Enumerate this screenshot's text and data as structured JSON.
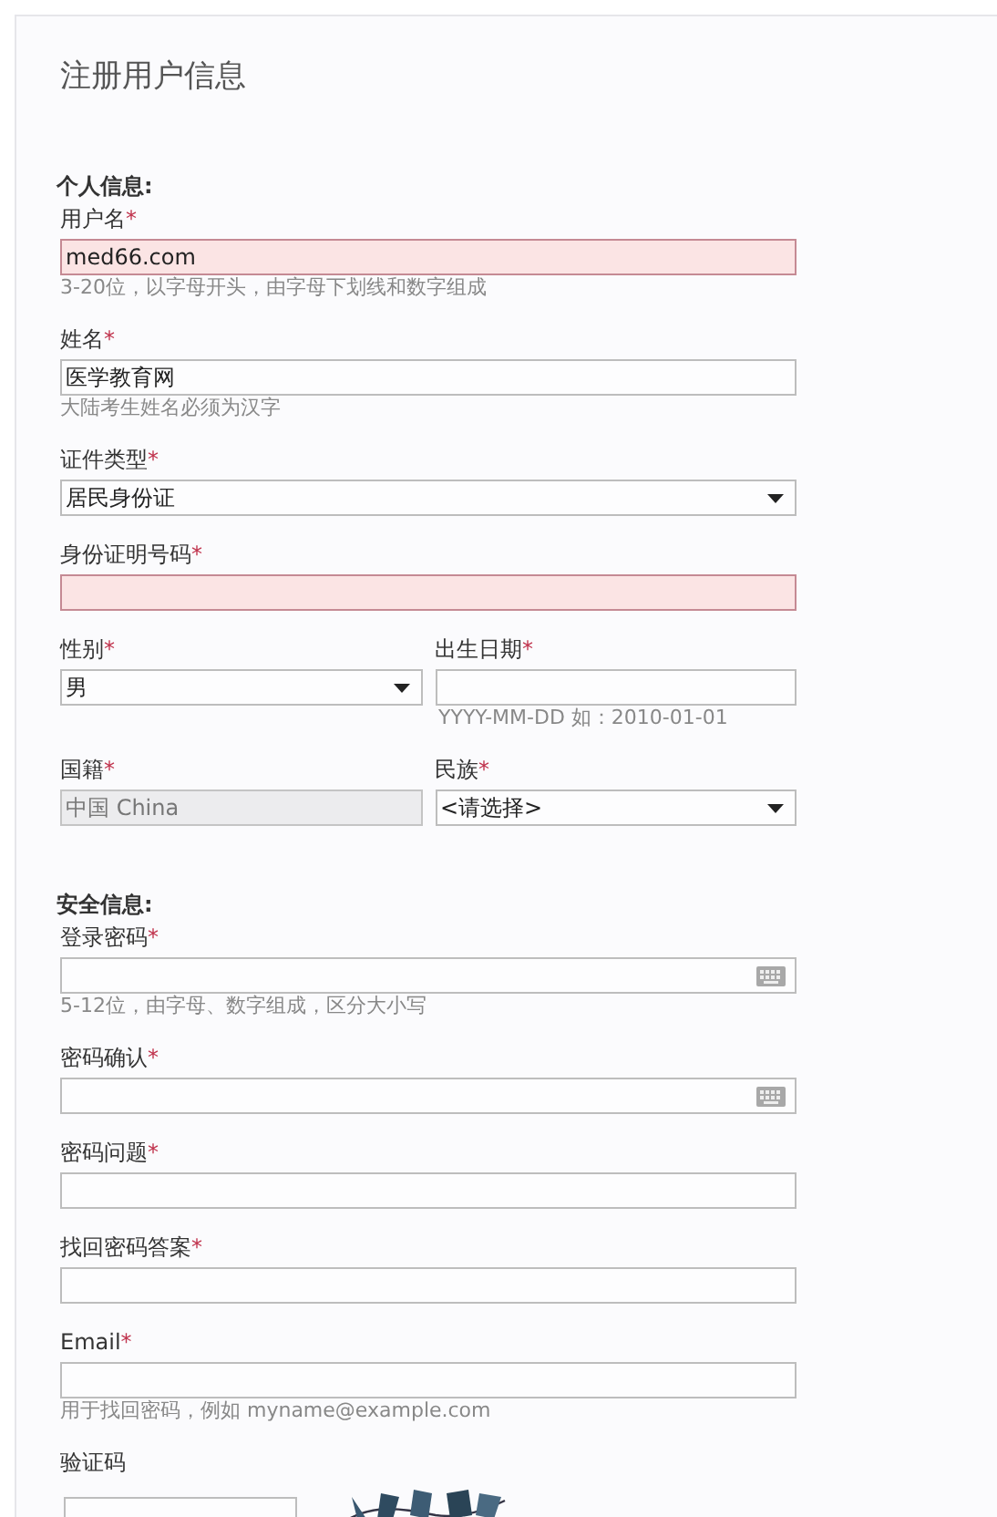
{
  "title": "注册用户信息",
  "sections": [
    {
      "heading": "个人信息:",
      "rows": [
        [
          {
            "label": "用户名",
            "mark": "*",
            "kind": "text",
            "value": "med66.com",
            "error": true,
            "hint": "3-20位，以字母开头，由字母下划线和数字组成"
          }
        ],
        [
          {
            "label": "姓名",
            "mark": "*",
            "kind": "text",
            "value": "医学教育网",
            "error": false,
            "hint": "大陆考生姓名必须为汉字"
          }
        ],
        [
          {
            "label": "证件类型",
            "mark": "*",
            "kind": "select",
            "value": "居民身份证",
            "error": false
          }
        ],
        [
          {
            "label": "身份证明号码",
            "mark": "*",
            "kind": "text",
            "error": true
          }
        ],
        [
          {
            "label": "性别",
            "mark": "*",
            "kind": "select",
            "value": "男",
            "error": false
          },
          {
            "label": "出生日期",
            "mark": "*",
            "kind": "text",
            "error": false,
            "hint": "YYYY-MM-DD 如：2010-01-01"
          }
        ],
        [
          {
            "label": "国籍",
            "mark": "*",
            "kind": "disabled",
            "value": "中国 China",
            "error": false
          },
          {
            "label": "民族",
            "mark": "*",
            "kind": "select",
            "value": "<请选择>",
            "error": false
          }
        ]
      ]
    },
    {
      "heading": "安全信息:",
      "rows": [
        [
          {
            "label": "登录密码",
            "mark": "*",
            "kind": "password",
            "error": false,
            "hint": "5-12位，由字母、数字组成，区分大小写"
          }
        ],
        [
          {
            "label": "密码确认",
            "mark": "*",
            "kind": "password",
            "error": false
          }
        ],
        [
          {
            "label": "密码问题",
            "mark": "*",
            "kind": "text",
            "error": false
          }
        ],
        [
          {
            "label": "找回密码答案",
            "mark": "*",
            "kind": "text",
            "error": false
          }
        ],
        [
          {
            "label": "Email",
            "mark": "*",
            "kind": "text",
            "error": false,
            "hint": "用于找回密码，例如 myname@example.com"
          }
        ],
        [
          {
            "label": "验证码",
            "kind": "captcha",
            "error": false
          }
        ]
      ]
    }
  ]
}
